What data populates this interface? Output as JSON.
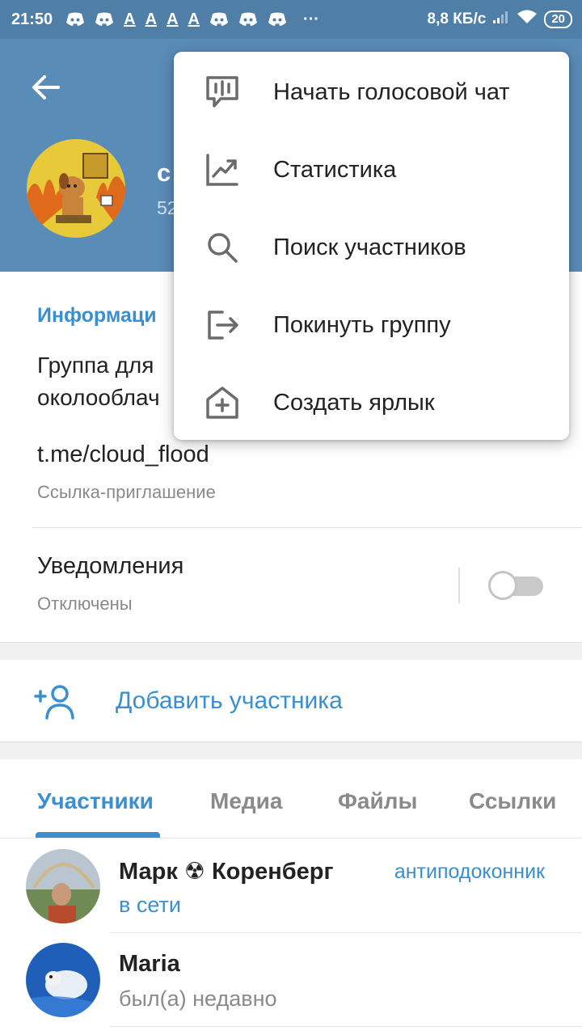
{
  "status_bar": {
    "time": "21:50",
    "letter": "A",
    "more": "···",
    "speed": "8,8 КБ/с",
    "battery": "20"
  },
  "header": {
    "title": "c",
    "subtitle": "52"
  },
  "info": {
    "section_title": "Информаци",
    "description_line1": "Группа для",
    "description_line2": "околооблач",
    "link": "t.me/cloud_flood",
    "link_caption": "Ссылка-приглашение",
    "notifications_label": "Уведомления",
    "notifications_status": "Отключены",
    "notifications_enabled": false
  },
  "add_member": {
    "label": "Добавить участника"
  },
  "tabs": [
    {
      "label": "Участники",
      "active": true
    },
    {
      "label": "Медиа",
      "active": false
    },
    {
      "label": "Файлы",
      "active": false
    },
    {
      "label": "Ссылки",
      "active": false
    }
  ],
  "members": [
    {
      "name": "Марк ☢ Коренберг",
      "role": "антиподоконник",
      "status": "в сети",
      "online": true
    },
    {
      "name": "Maria",
      "role": "",
      "status": "был(а) недавно",
      "online": false
    }
  ],
  "menu": {
    "items": [
      {
        "label": "Начать голосовой чат",
        "icon": "voice-chat-icon"
      },
      {
        "label": "Статистика",
        "icon": "statistics-icon"
      },
      {
        "label": "Поиск участников",
        "icon": "search-icon"
      },
      {
        "label": "Покинуть группу",
        "icon": "leave-icon"
      },
      {
        "label": "Создать ярлык",
        "icon": "shortcut-icon"
      }
    ]
  },
  "colors": {
    "header": "#5a8cb8",
    "status_bar": "#4f7ea6",
    "accent": "#3a8fd0"
  }
}
